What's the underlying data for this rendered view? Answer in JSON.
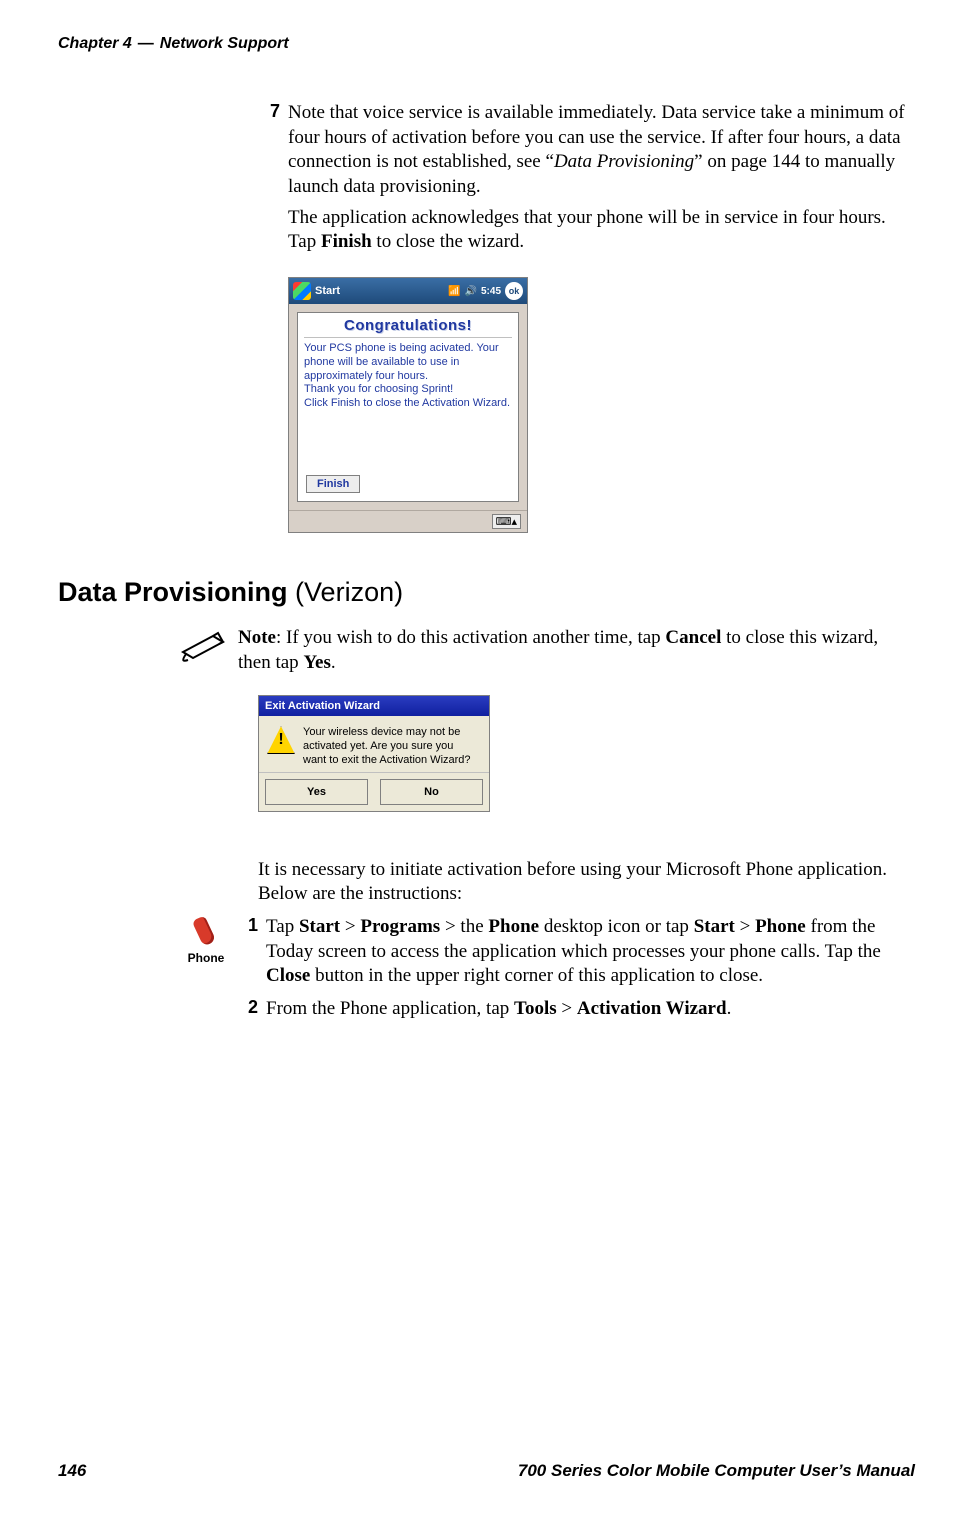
{
  "header": {
    "chapter": "Chapter 4",
    "dash": "—",
    "title": "Network Support"
  },
  "step7": {
    "num": "7",
    "text_before_italic": "Note that voice service is available immediately. Data service take a minimum of four hours of activation before you can use the service. If after four hours, a data connection is not established, see “",
    "italic": "Data Provisioning",
    "text_after_italic": "” on page 144 to manually launch data provisioning.",
    "cont_before_bold": "The application acknowledges that your phone will be in service in four hours. Tap ",
    "cont_bold": "Finish",
    "cont_after_bold": " to close the wizard."
  },
  "shot1": {
    "start": "Start",
    "time": "5:45",
    "ok": "ok",
    "congrats": "Congratulations!",
    "body": "Your PCS phone is being acivated. Your phone will be available to use in approximately four hours.\nThank you for choosing Sprint!\nClick Finish to close the Activation Wizard.",
    "finish": "Finish",
    "kbd": "⌨▴"
  },
  "section": {
    "strong": "Data Provisioning",
    "light": " (Verizon)"
  },
  "note": {
    "label_bold": "Note",
    "text_a": ": If you wish to do this activation another time, tap ",
    "cancel": "Cancel",
    "text_b": " to close this wizard, then tap ",
    "yes": "Yes",
    "text_c": "."
  },
  "shot2": {
    "title": "Exit Activation Wizard",
    "msg": "Your wireless device may not be activated yet.  Are you sure you want to exit the Activation Wizard?",
    "yes": "Yes",
    "no": "No"
  },
  "para_intro": "It is necessary to initiate activation before using your Microsoft Phone application. Below are the instructions:",
  "phone_label": "Phone",
  "step1": {
    "num": "1",
    "a": "Tap ",
    "b1": "Start",
    "c": " > ",
    "b2": "Programs",
    "d": " > the ",
    "b3": "Phone",
    "e": " desktop icon or tap ",
    "b4": "Start",
    "f": " > ",
    "b5": "Phone",
    "g": " from the Today screen to access the application which processes your phone calls. Tap the ",
    "b6": "Close",
    "h": " button in the upper right corner of this application to close."
  },
  "step2": {
    "num": "2",
    "a": "From the Phone application, tap ",
    "b1": "Tools",
    "c": " > ",
    "b2": "Activation Wizard",
    "d": "."
  },
  "footer": {
    "page": "146",
    "title": "700 Series Color Mobile Computer User’s Manual"
  }
}
